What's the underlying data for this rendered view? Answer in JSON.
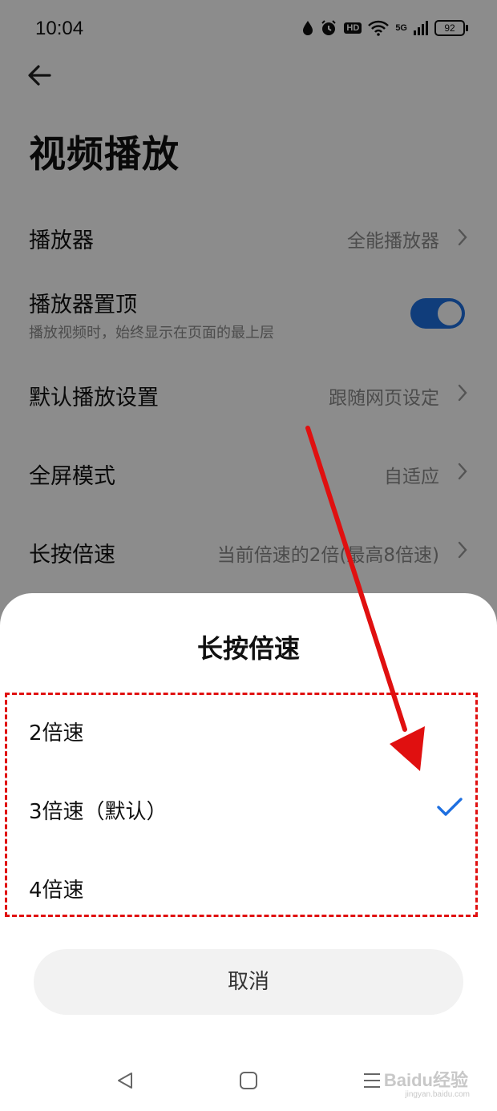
{
  "status_bar": {
    "time": "10:04",
    "hd_label": "HD",
    "signal_label": "5G",
    "battery_level": "92"
  },
  "header": {
    "title": "视频播放"
  },
  "settings": {
    "player": {
      "label": "播放器",
      "value": "全能播放器"
    },
    "pin_player": {
      "label": "播放器置顶",
      "description": "播放视频时，始终显示在页面的最上层",
      "enabled": true
    },
    "default_play": {
      "label": "默认播放设置",
      "value": "跟随网页设定"
    },
    "fullscreen": {
      "label": "全屏模式",
      "value": "自适应"
    },
    "long_press_speed": {
      "label": "长按倍速",
      "value": "当前倍速的2倍(最高8倍速)"
    }
  },
  "sheet": {
    "title": "长按倍速",
    "options": [
      {
        "label": "2倍速",
        "selected": false
      },
      {
        "label": "3倍速（默认）",
        "selected": true
      },
      {
        "label": "4倍速",
        "selected": false
      }
    ],
    "cancel_label": "取消"
  },
  "watermark": {
    "brand": "Baidu经验",
    "url": "jingyan.baidu.com"
  },
  "colors": {
    "accent": "#1e6fe0",
    "annotation_red": "#e01010"
  }
}
